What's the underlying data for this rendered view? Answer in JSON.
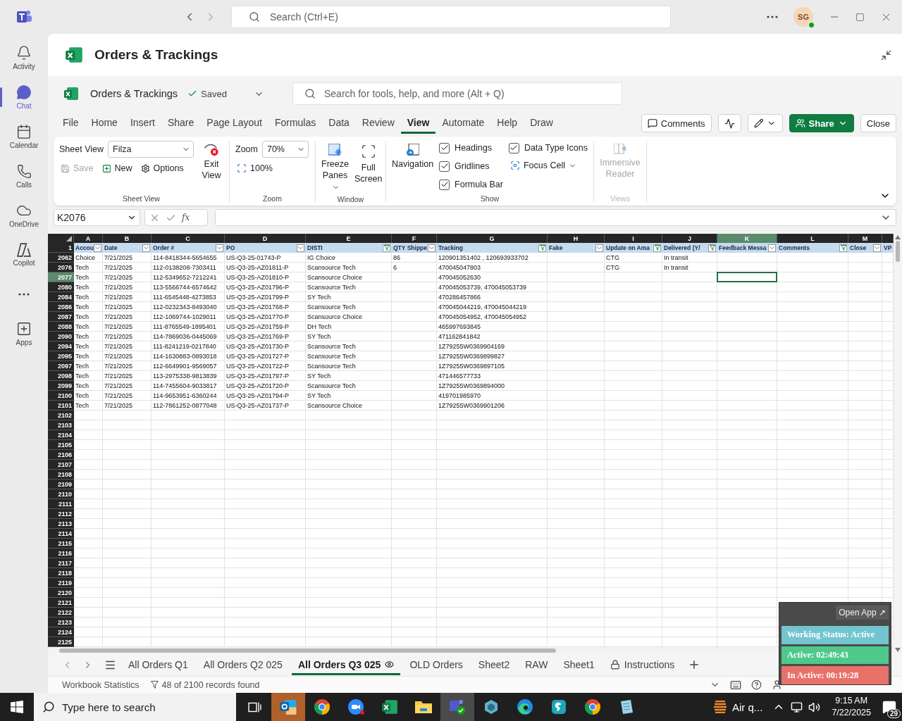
{
  "teams_bar": {
    "search_placeholder": "Search (Ctrl+E)",
    "avatar": "SG"
  },
  "rail": [
    {
      "kind": "activity",
      "label": "Activity",
      "selected": false
    },
    {
      "kind": "chat",
      "label": "Chat",
      "selected": true
    },
    {
      "kind": "calendar",
      "label": "Calendar",
      "selected": false
    },
    {
      "kind": "calls",
      "label": "Calls",
      "selected": false
    },
    {
      "kind": "onedrive",
      "label": "OneDrive",
      "selected": false
    },
    {
      "kind": "copilot",
      "label": "Copilot",
      "selected": false
    },
    {
      "kind": "more",
      "selected": false
    },
    {
      "kind": "apps",
      "label": "Apps",
      "selected": false
    }
  ],
  "app_header": {
    "title": "Orders & Trackings"
  },
  "excel_bar": {
    "file_name": "Orders & Trackings",
    "save_status": "Saved",
    "search_placeholder": "Search for tools, help, and more (Alt + Q)"
  },
  "menu_tabs": [
    {
      "label": "File",
      "selected": false
    },
    {
      "label": "Home",
      "selected": false
    },
    {
      "label": "Insert",
      "selected": false
    },
    {
      "label": "Share",
      "selected": false
    },
    {
      "label": "Page Layout",
      "selected": false
    },
    {
      "label": "Formulas",
      "selected": false
    },
    {
      "label": "Data",
      "selected": false
    },
    {
      "label": "Review",
      "selected": false
    },
    {
      "label": "View",
      "selected": true
    },
    {
      "label": "Automate",
      "selected": false
    },
    {
      "label": "Help",
      "selected": false
    },
    {
      "label": "Draw",
      "selected": false
    }
  ],
  "actions": {
    "comments": "Comments",
    "share": "Share",
    "close": "Close"
  },
  "ribbon": {
    "sheet_view": {
      "label": "Sheet View",
      "view_name": "Filza",
      "save": {
        "label": "Save",
        "disabled": true
      },
      "new": "New",
      "options": "Options",
      "exit": "Exit View",
      "group": "Sheet View"
    },
    "zoom": {
      "label": "Zoom",
      "value": "70%",
      "reset": "100%",
      "group": "Zoom"
    },
    "window": {
      "freeze": "Freeze Panes",
      "full_screen": "Full Screen",
      "group": "Window"
    },
    "show": {
      "navigation": "Navigation",
      "checkboxes": [
        {
          "label": "Headings",
          "checked": true
        },
        {
          "label": "Gridlines",
          "checked": true
        },
        {
          "label": "Formula Bar",
          "checked": true
        },
        {
          "label": "Data Type Icons",
          "checked": true
        }
      ],
      "focus_cell": "Focus Cell",
      "group": "Show"
    },
    "views": {
      "immersive_reader": "Immersive Reader",
      "disabled": true,
      "group": "Views"
    }
  },
  "formula_bar": {
    "name_box": "K2076",
    "function_label": "fx"
  },
  "sheet": {
    "header_row_number": "1",
    "columns": [
      {
        "letter": "A",
        "title": "Accou",
        "filtered": false,
        "selected": false
      },
      {
        "letter": "B",
        "title": "Date",
        "filtered": false,
        "selected": false
      },
      {
        "letter": "C",
        "title": "Order #",
        "filtered": false,
        "selected": false
      },
      {
        "letter": "D",
        "title": "PO",
        "filtered": false,
        "selected": false
      },
      {
        "letter": "E",
        "title": "DISTI",
        "filtered": true,
        "selected": false
      },
      {
        "letter": "F",
        "title": "QTY Shippe",
        "filtered": false,
        "selected": false
      },
      {
        "letter": "G",
        "title": "Tracking",
        "filtered": true,
        "selected": false
      },
      {
        "letter": "H",
        "title": "Fake",
        "filtered": false,
        "selected": false
      },
      {
        "letter": "I",
        "title": "Update on Ama",
        "filtered": true,
        "selected": false
      },
      {
        "letter": "J",
        "title": "Delivered (Y/",
        "filtered": true,
        "selected": false
      },
      {
        "letter": "K",
        "title": "Feedback Messa",
        "filtered": false,
        "selected": true
      },
      {
        "letter": "L",
        "title": "Comments",
        "filtered": true,
        "selected": false
      },
      {
        "letter": "M",
        "title": "Close",
        "filtered": false,
        "selected": false
      },
      {
        "title": "VP",
        "selected": false
      }
    ],
    "rows": [
      {
        "num": "2062",
        "selected": false,
        "account": "Choice",
        "date": "7/21/2025",
        "order": "114-8418344-5654655",
        "po": "US-Q3-25-01743-P",
        "disti": "IG Choice",
        "qty": "86",
        "tracking": "120901351402 , 120693933702",
        "update": "CTG",
        "delivered": "In transit"
      },
      {
        "num": "2076",
        "selected": false,
        "account": "Tech",
        "date": "7/21/2025",
        "order": "112-0138208-7303411",
        "po": "US-Q3-25-AZ01811-P",
        "disti": "Scansource Tech",
        "qty": "6",
        "tracking": "470045047803",
        "update": "CTG",
        "delivered": "In transit"
      },
      {
        "num": "2077",
        "selected": true,
        "account": "Tech",
        "date": "7/21/2025",
        "order": "112-5349652-7212241",
        "po": "US-Q3-25-AZ01810-P",
        "disti": "Scansource Choice",
        "tracking": "470045052630"
      },
      {
        "num": "2080",
        "selected": false,
        "account": "Tech",
        "date": "7/21/2025",
        "order": "113-5566744-6574642",
        "po": "US-Q3-25-AZ01796-P",
        "disti": "Scansource Tech",
        "tracking": "470045053739, 470045053739"
      },
      {
        "num": "2084",
        "selected": false,
        "account": "Tech",
        "date": "7/21/2025",
        "order": "111-6545448-4273853",
        "po": "US-Q3-25-AZ01799-P",
        "disti": "SY Tech",
        "tracking": "470286457866"
      },
      {
        "num": "2086",
        "selected": false,
        "account": "Tech",
        "date": "7/21/2025",
        "order": "112-0232343-8493040",
        "po": "US-Q3-25-AZ01768-P",
        "disti": "Scansource Tech",
        "tracking": "470045044219, 470045044219"
      },
      {
        "num": "2087",
        "selected": false,
        "account": "Tech",
        "date": "7/21/2025",
        "order": "112-1069744-1029011",
        "po": "US-Q3-25-AZ01770-P",
        "disti": "Scansource Choice",
        "tracking": "470045054952, 470045054952"
      },
      {
        "num": "2088",
        "selected": false,
        "account": "Tech",
        "date": "7/21/2025",
        "order": "111-8765549-1895401",
        "po": "US-Q3-25-AZ01759-P",
        "disti": "DH Tech",
        "tracking": "465997693845"
      },
      {
        "num": "2090",
        "selected": false,
        "account": "Tech",
        "date": "7/21/2025",
        "order": "114-7869036-0445069",
        "po": "US-Q3-25-AZ01769-P",
        "disti": "SY Tech",
        "tracking": "471162841842"
      },
      {
        "num": "2094",
        "selected": false,
        "account": "Tech",
        "date": "7/21/2025",
        "order": "111-8241219-0217840",
        "po": "US-Q3-25-AZ01730-P",
        "disti": "Scansource Tech",
        "tracking": "1Z79255W0369904169"
      },
      {
        "num": "2095",
        "selected": false,
        "account": "Tech",
        "date": "7/21/2025",
        "order": "114-1630883-0893018",
        "po": "US-Q3-25-AZ01727-P",
        "disti": "Scansource Tech",
        "tracking": "1Z79255W0369899827"
      },
      {
        "num": "2097",
        "selected": false,
        "account": "Tech",
        "date": "7/21/2025",
        "order": "112-6649901-9569057",
        "po": "US-Q3-25-AZ01722-P",
        "disti": "Scansource Tech",
        "tracking": "1Z79255W0369897105"
      },
      {
        "num": "2098",
        "selected": false,
        "account": "Tech",
        "date": "7/21/2025",
        "order": "113-2975338-9813839",
        "po": "US-Q3-25-AZ01797-P",
        "disti": "SY Tech",
        "tracking": "471446577733"
      },
      {
        "num": "2099",
        "selected": false,
        "account": "Tech",
        "date": "7/21/2025",
        "order": "114-7455604-9033817",
        "po": "US-Q3-25-AZ01720-P",
        "disti": "Scansource Tech",
        "tracking": "1Z79255W0369894000"
      },
      {
        "num": "2100",
        "selected": false,
        "account": "Tech",
        "date": "7/21/2025",
        "order": "114-9653951-6360244",
        "po": "US-Q3-25-AZ01794-P",
        "disti": "SY Tech",
        "tracking": "419701985970"
      },
      {
        "num": "2101",
        "selected": false,
        "account": "Tech",
        "date": "7/21/2025",
        "order": "112-7861252-0877048",
        "po": "US-Q3-25-AZ01737-P",
        "disti": "Scansource Choice",
        "tracking": "1Z79255W0369901206"
      },
      {
        "num": "2102",
        "selected": false
      },
      {
        "num": "2103",
        "selected": false
      },
      {
        "num": "2104",
        "selected": false
      },
      {
        "num": "2105",
        "selected": false
      },
      {
        "num": "2106",
        "selected": false
      },
      {
        "num": "2107",
        "selected": false
      },
      {
        "num": "2108",
        "selected": false
      },
      {
        "num": "2109",
        "selected": false
      },
      {
        "num": "2110",
        "selected": false
      },
      {
        "num": "2111",
        "selected": false
      },
      {
        "num": "2112",
        "selected": false
      },
      {
        "num": "2113",
        "selected": false
      },
      {
        "num": "2114",
        "selected": false
      },
      {
        "num": "2115",
        "selected": false
      },
      {
        "num": "2116",
        "selected": false
      },
      {
        "num": "2117",
        "selected": false
      },
      {
        "num": "2118",
        "selected": false
      },
      {
        "num": "2119",
        "selected": false
      },
      {
        "num": "2120",
        "selected": false
      },
      {
        "num": "2121",
        "selected": false
      },
      {
        "num": "2122",
        "selected": false
      },
      {
        "num": "2123",
        "selected": false
      },
      {
        "num": "2124",
        "selected": false
      },
      {
        "num": "2125",
        "selected": false
      }
    ]
  },
  "sheet_tabs": [
    {
      "kind": "sheet",
      "label": "All Orders Q1",
      "selected": false
    },
    {
      "kind": "sheet",
      "label": "All Orders Q2 025",
      "selected": false
    },
    {
      "kind": "viewed",
      "label": "All Orders Q3 025",
      "selected": true
    },
    {
      "kind": "sheet",
      "label": "OLD Orders",
      "selected": false
    },
    {
      "kind": "sheet",
      "label": "Sheet2",
      "selected": false
    },
    {
      "kind": "sheet",
      "label": "RAW",
      "selected": false
    },
    {
      "kind": "sheet",
      "label": "Sheet1",
      "selected": false
    },
    {
      "kind": "protected",
      "label": "Instructions",
      "selected": false
    }
  ],
  "status_bar": {
    "statistics": "Workbook Statistics",
    "records": "48 of 2100 records found"
  },
  "tracker": {
    "open_app": "Open App ↗",
    "statuses": [
      {
        "text": "Working Status: Active",
        "color": "#72c5cf"
      },
      {
        "text": "Active: 02:49:43",
        "color": "#4fc98a"
      },
      {
        "text": "In Active: 00:19:28",
        "color": "#e8716a"
      }
    ]
  },
  "taskbar": {
    "search_placeholder": "Type here to search",
    "apps": [
      {
        "kind": "outlook",
        "selected": false,
        "attention": true
      },
      {
        "kind": "chrome",
        "selected": false,
        "attention": false
      },
      {
        "kind": "zoom",
        "selected": false,
        "attention": false
      },
      {
        "kind": "excel",
        "selected": false,
        "attention": false
      },
      {
        "kind": "explorer",
        "selected": false,
        "attention": false
      },
      {
        "kind": "teams",
        "selected": true,
        "attention": false
      },
      {
        "kind": "cube",
        "selected": false,
        "attention": false
      },
      {
        "kind": "edge",
        "selected": false,
        "attention": false
      },
      {
        "kind": "surfshark",
        "selected": false,
        "attention": false
      },
      {
        "kind": "chrome",
        "selected": false,
        "attention": false
      },
      {
        "kind": "notepad",
        "selected": false,
        "attention": false
      }
    ],
    "weather": "Air q...",
    "time": "9:15 AM",
    "date": "7/22/2025",
    "notifications": "29"
  }
}
